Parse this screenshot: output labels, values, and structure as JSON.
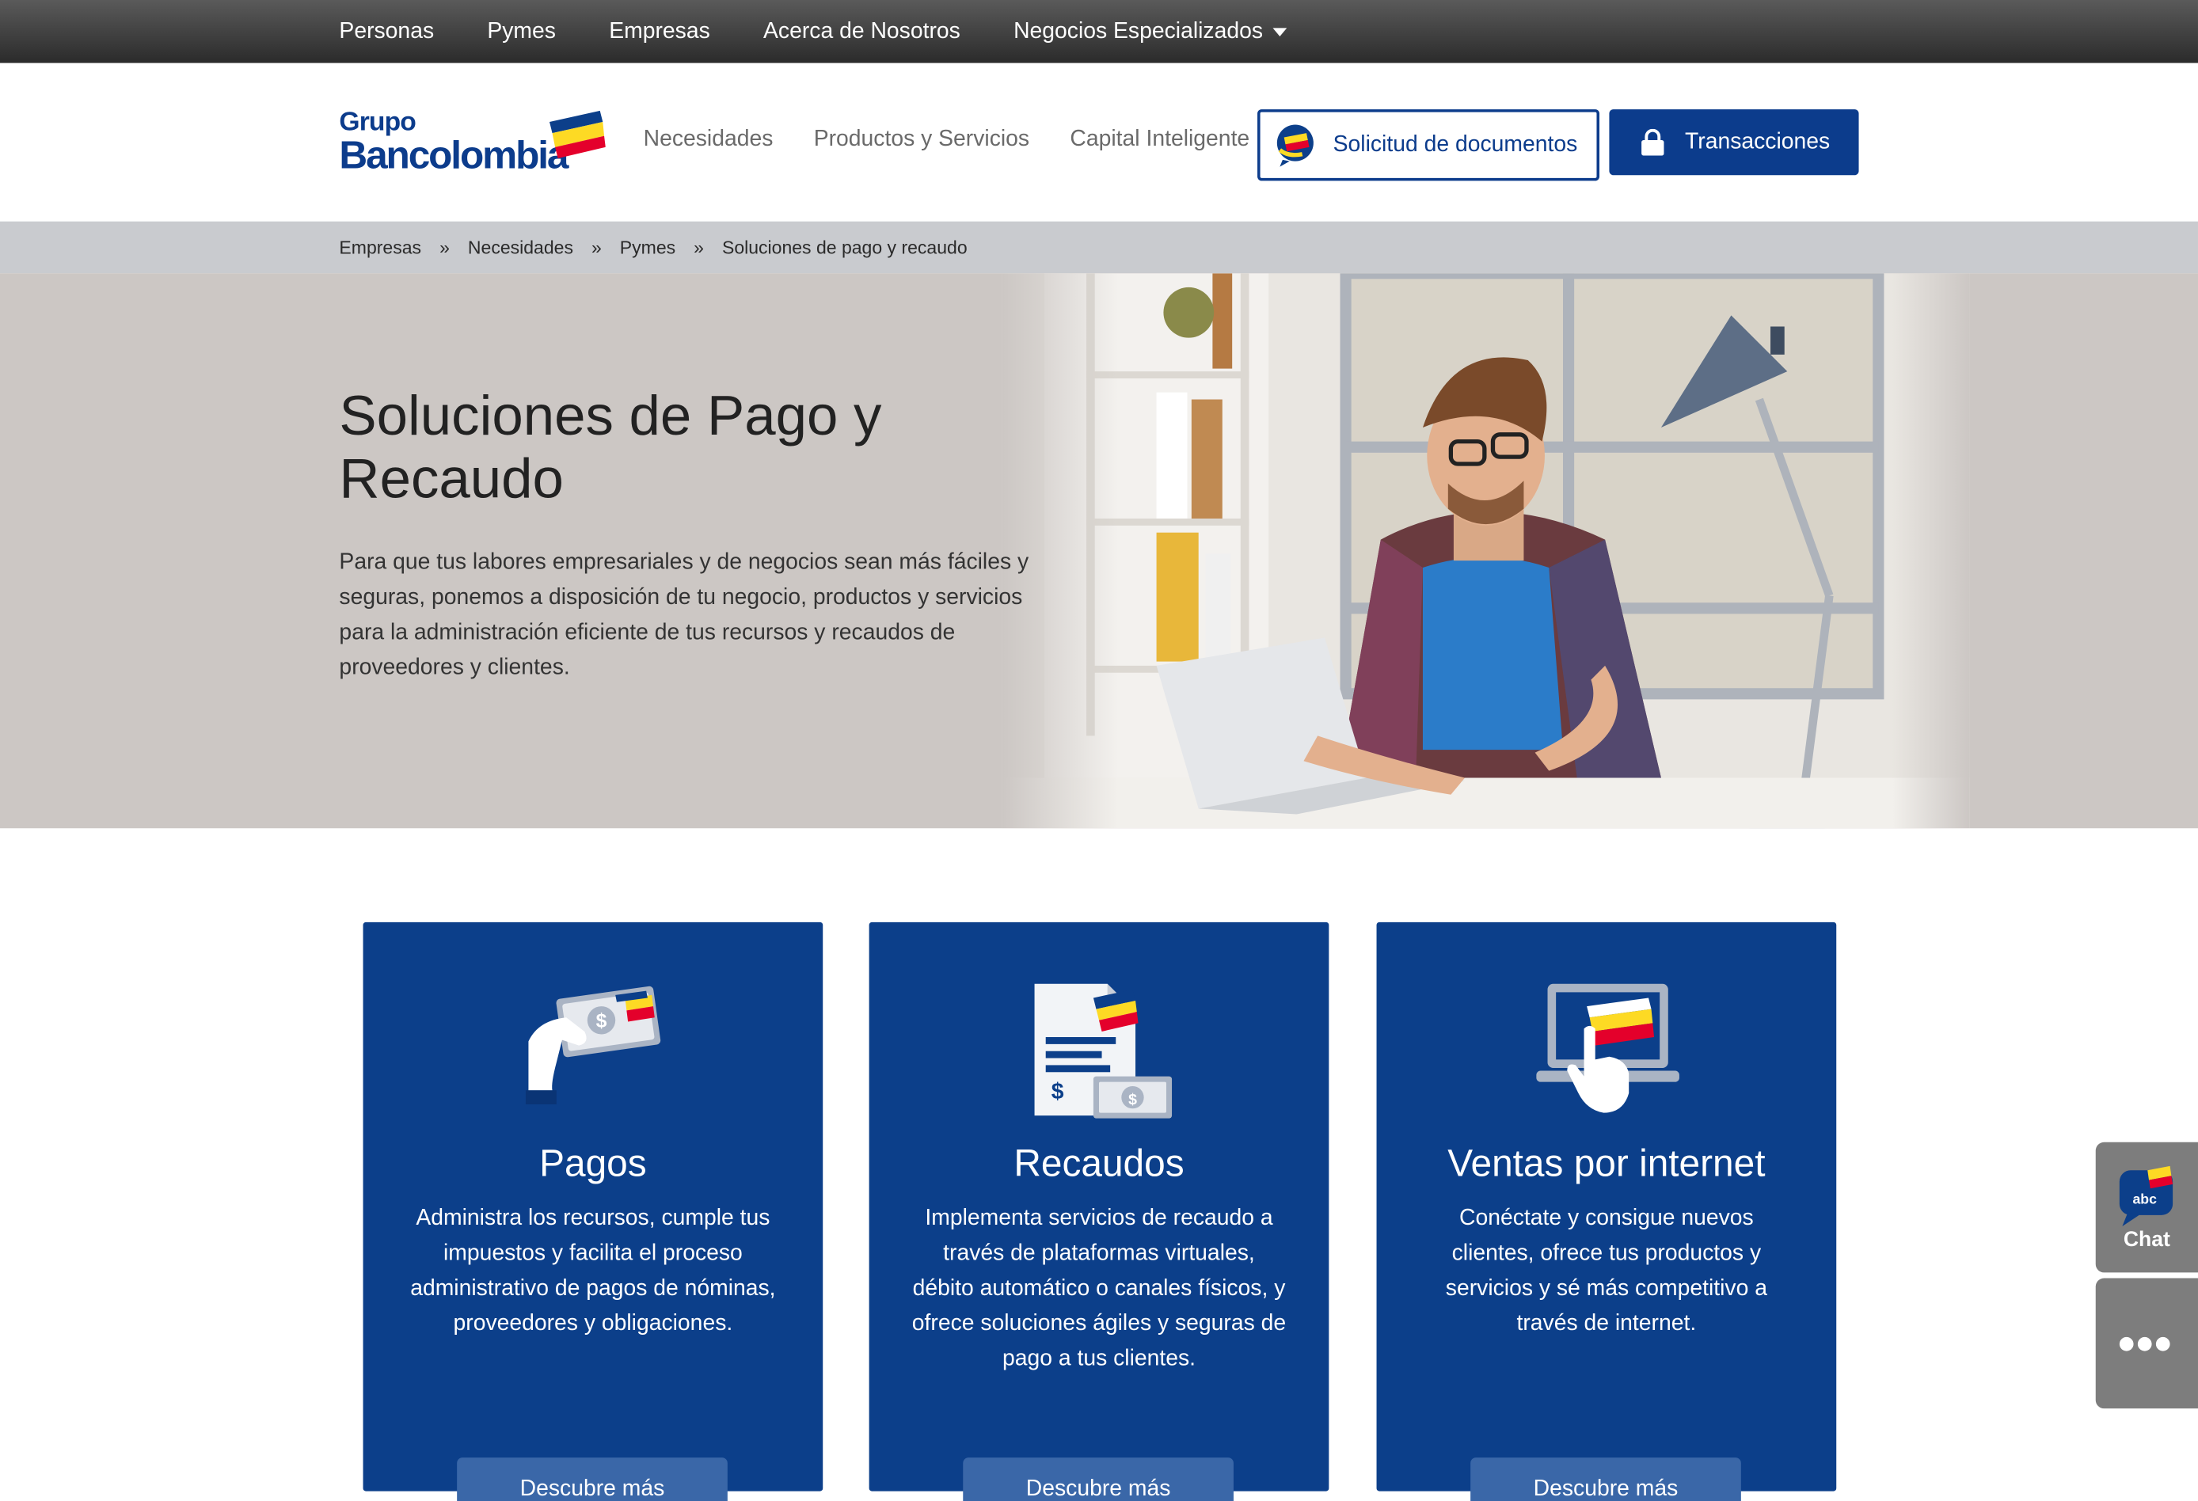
{
  "topbar": {
    "items": [
      "Personas",
      "Pymes",
      "Empresas",
      "Acerca de Nosotros",
      "Negocios Especializados"
    ]
  },
  "header": {
    "logo_line1": "Grupo",
    "logo_line2": "Bancolombia",
    "nav": [
      "Necesidades",
      "Productos y Servicios",
      "Capital Inteligente"
    ],
    "docs_button": "Solicitud de documentos",
    "transactions_button": "Transacciones"
  },
  "breadcrumb": {
    "items": [
      "Empresas",
      "Necesidades",
      "Pymes",
      "Soluciones de pago y recaudo"
    ],
    "separator": "»"
  },
  "hero": {
    "title": "Soluciones de Pago y Recaudo",
    "text": "Para que tus labores empresariales y de negocios sean más fáciles y seguras, ponemos a disposición de tu negocio, productos y servicios para la administración eficiente de tus recursos y recaudos de proveedores y clientes."
  },
  "cards": [
    {
      "icon": "hand-card-payment-icon",
      "title": "Pagos",
      "text": "Administra los recursos, cumple tus impuestos y facilita el proceso administrativo de pagos de nóminas, proveedores y obligaciones.",
      "button": "Descubre más"
    },
    {
      "icon": "invoice-money-icon",
      "title": "Recaudos",
      "text": "Implementa servicios de recaudo a través de plataformas virtuales, débito automático o canales físicos, y ofrece soluciones ágiles y seguras de pago a tus clientes.",
      "button": "Descubre más"
    },
    {
      "icon": "laptop-touch-icon",
      "title": "Ventas por internet",
      "text": "Conéctate y consigue nuevos clientes, ofrece tus productos y servicios y sé más competitivo a través de internet.",
      "button": "Descubre más"
    }
  ],
  "side_widgets": {
    "chat_badge": "abc",
    "chat_label": "Chat"
  },
  "colors": {
    "brand_blue": "#0c3f8a",
    "brand_yellow": "#fdda24",
    "brand_red": "#e4002b",
    "topbar": "#3a3a3a",
    "breadcrumb_bg": "#c9cbcf"
  }
}
